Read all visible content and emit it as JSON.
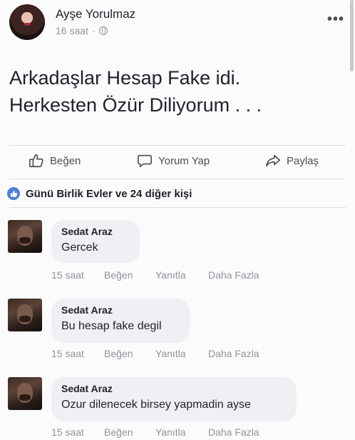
{
  "post": {
    "author": "Ayşe Yorulmaz",
    "time": "16 saat",
    "separator": "·",
    "privacy_icon": "globe-icon",
    "more_icon": "more-horizontal-icon",
    "text_line1": "Arkadaşlar Hesap Fake idi.",
    "text_line2": "Herkesten Özür Diliyorum . . ."
  },
  "actions": {
    "like_label": "Beğen",
    "comment_label": "Yorum Yap",
    "share_label": "Paylaş"
  },
  "reactions": {
    "text": "Günü Birlik Evler ve 24 diğer kişi"
  },
  "comments": [
    {
      "name": "Sedat Araz",
      "text": "Gercek",
      "time": "15 saat",
      "like": "Beğen",
      "reply": "Yanıtla",
      "more": "Daha Fazla"
    },
    {
      "name": "Sedat Araz",
      "text": "Bu hesap fake degil",
      "time": "15 saat",
      "like": "Beğen",
      "reply": "Yanıtla",
      "more": "Daha Fazla"
    },
    {
      "name": "Sedat Araz",
      "text": "Ozur dilenecek birsey yapmadin ayse",
      "time": "15 saat",
      "like": "Beğen",
      "reply": "Yanıtla",
      "more": "Daha Fazla"
    }
  ],
  "colors": {
    "like_badge": "#4e7ed6",
    "bubble": "#eff0f3",
    "muted_text": "#90949c"
  }
}
